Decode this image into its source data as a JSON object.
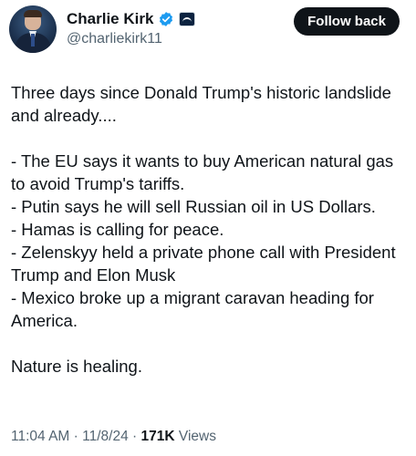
{
  "author": {
    "display_name": "Charlie Kirk",
    "handle": "@charliekirk11",
    "verified_color": "#1d9bf0"
  },
  "follow_button": {
    "label": "Follow back"
  },
  "tweet": {
    "paragraphs": [
      [
        "Three days since Donald Trump's historic landslide and already...."
      ],
      [
        "- The EU says it wants to buy American natural gas to avoid Trump's tariffs.",
        "- Putin says he will sell Russian oil in US Dollars.",
        "- Hamas is calling for peace.",
        "- Zelenskyy held a private phone call with President Trump and Elon Musk",
        "- Mexico broke up a migrant caravan heading for America."
      ],
      [
        "Nature is healing."
      ]
    ]
  },
  "meta": {
    "time": "11:04 AM",
    "separator": "·",
    "date": "11/8/24",
    "views_count": "171K",
    "views_label": "Views"
  }
}
